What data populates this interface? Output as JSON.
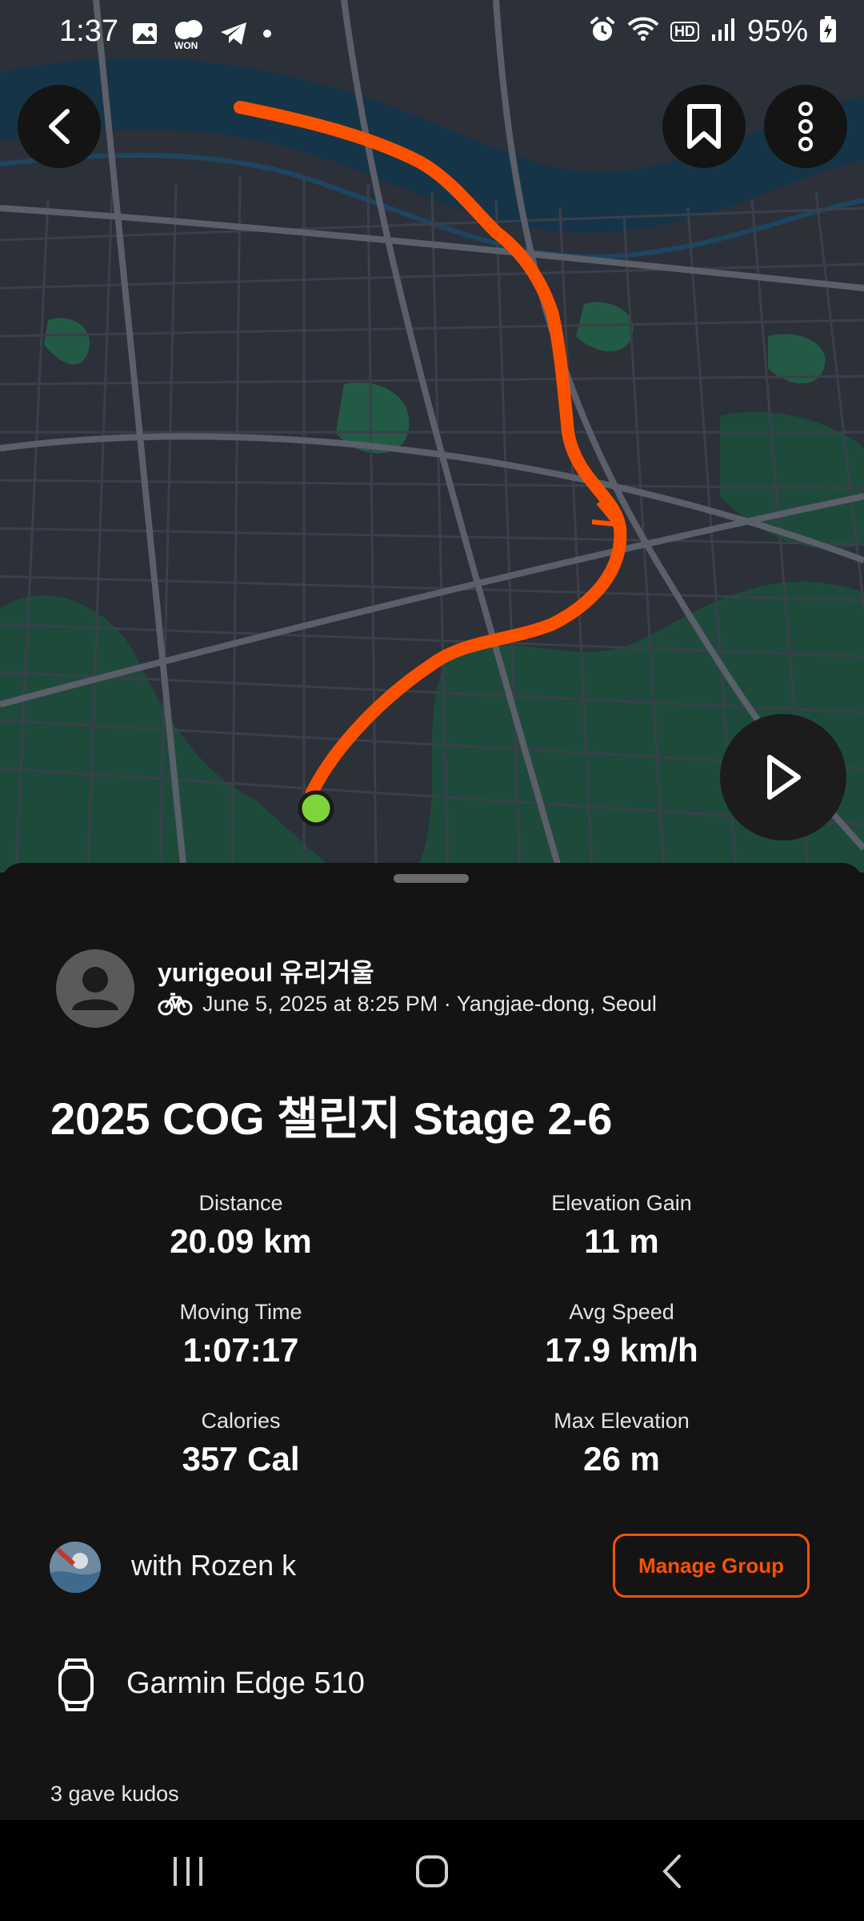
{
  "status_bar": {
    "time": "1:37",
    "left_icons": [
      "gallery-icon",
      "won-icon",
      "telegram-icon",
      "dot-icon"
    ],
    "won_label": "WON",
    "right_icons": [
      "alarm-icon",
      "wifi-icon",
      "hd-icon",
      "signal-icon"
    ],
    "hd_label": "HD",
    "battery": "95%"
  },
  "map": {
    "route_color": "#fc5200",
    "start_marker_color": "#7dd43c"
  },
  "activity": {
    "username": "yurigeoul 유리거울",
    "meta": "June 5, 2025 at 8:25 PM · Yangjae-dong, Seoul",
    "title": "2025 COG 챌린지 Stage 2-6",
    "stats": [
      {
        "label": "Distance",
        "value": "20.09 km"
      },
      {
        "label": "Elevation Gain",
        "value": "11 m"
      },
      {
        "label": "Moving Time",
        "value": "1:07:17"
      },
      {
        "label": "Avg Speed",
        "value": "17.9 km/h"
      },
      {
        "label": "Calories",
        "value": "357 Cal"
      },
      {
        "label": "Max Elevation",
        "value": "26 m"
      }
    ],
    "group_text": "with Rozen k",
    "manage_group_label": "Manage Group",
    "device": "Garmin Edge 510",
    "kudos": "3 gave kudos"
  },
  "colors": {
    "accent": "#fc5200",
    "background": "#141414"
  }
}
